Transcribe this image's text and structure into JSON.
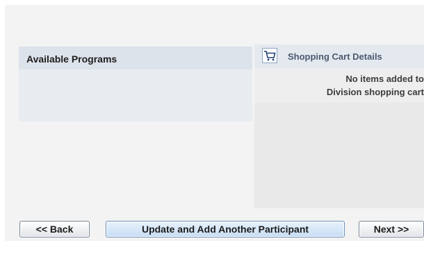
{
  "programs": {
    "title": "Available Programs"
  },
  "cart": {
    "title": "Shopping Cart Details",
    "icon": "shopping-cart-icon",
    "message_line1": "No items added to",
    "message_line2": "Division shopping cart"
  },
  "buttons": {
    "back_label": "<< Back",
    "update_label": "Update and Add Another Participant",
    "next_label": "Next >>"
  }
}
